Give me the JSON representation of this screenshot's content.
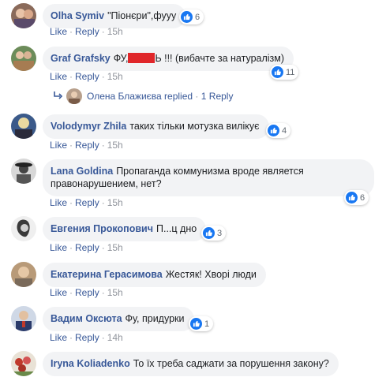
{
  "actions": {
    "like": "Like",
    "reply": "Reply",
    "dot": "·"
  },
  "colors": {
    "link": "#385898",
    "bubble": "#f2f3f5",
    "like_blue": "#1877f2",
    "censor_red": "#e0262a"
  },
  "comments": [
    {
      "author": "Olha Symiv",
      "text": "\"Піонєри\",фууу",
      "reactions": "6",
      "time": "15h",
      "reaction_icon": "like-icon"
    },
    {
      "author": "Graf Grafsky",
      "text_before": "ФУ,",
      "text_after": "Ь !!! (вибачте за натуралізм)",
      "reactions": "11",
      "time": "15h",
      "reaction_icon": "like-icon"
    },
    {
      "author": "Volodymyr Zhila",
      "text": "таких тільки мотузка вилікує",
      "reactions": "4",
      "time": "15h",
      "reaction_icon": "like-icon"
    },
    {
      "author": "Lana Goldina",
      "text": "Пропаганда коммунизма вроде является правонарушением, нет?",
      "reactions": "6",
      "time": "15h",
      "reaction_icon": "like-icon"
    },
    {
      "author": "Евгения Прокопович",
      "text": "П...ц дно",
      "reactions": "3",
      "time": "15h",
      "reaction_icon": "like-icon"
    },
    {
      "author": "Екатерина Герасимова",
      "text": "Жестяк! Хворі люди",
      "reactions": "",
      "time": "15h",
      "reaction_icon": ""
    },
    {
      "author": "Вадим Оксюта",
      "text": "Фу, придурки",
      "reactions": "1",
      "time": "14h",
      "reaction_icon": "like-icon"
    },
    {
      "author": "Iryna Koliadenko",
      "text": "То їх треба саджати за порушення закону?",
      "reactions": "",
      "time": "",
      "reaction_icon": ""
    }
  ],
  "replies": {
    "name": "Олена Блажиєва",
    "label": "replied",
    "count": "1 Reply",
    "icon": "reply-arrow-icon"
  }
}
